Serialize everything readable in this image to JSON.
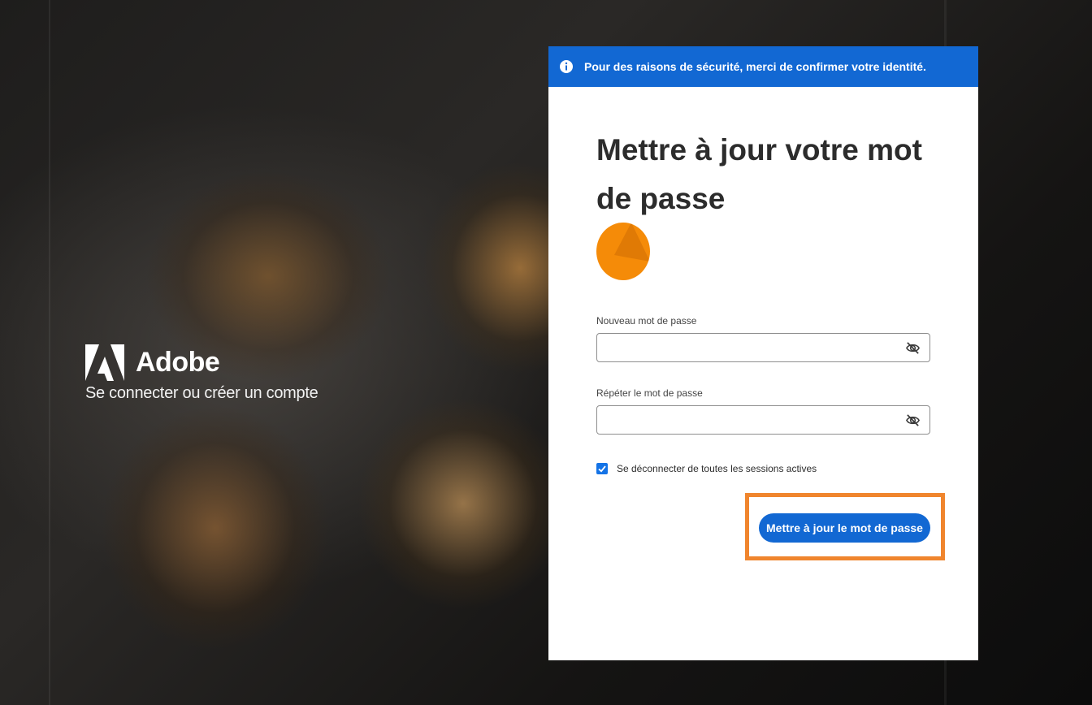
{
  "brand": {
    "name": "Adobe",
    "tagline": "Se connecter ou créer un compte"
  },
  "banner": {
    "icon": "info-icon",
    "text": "Pour des raisons de sécurité, merci de confirmer votre identité."
  },
  "form": {
    "title": "Mettre à jour votre mot de passe",
    "new_password": {
      "label": "Nouveau mot de passe",
      "value": "",
      "icon": "eye-off-icon"
    },
    "repeat_password": {
      "label": "Répéter le mot de passe",
      "value": "",
      "icon": "eye-off-icon"
    },
    "signout_all": {
      "label": "Se déconnecter de toutes les sessions actives",
      "checked": true
    },
    "submit_label": "Mettre à jour le mot de passe"
  },
  "colors": {
    "accent": "#1268d3",
    "avatar": "#f58b08",
    "highlight": "#f0852d"
  }
}
